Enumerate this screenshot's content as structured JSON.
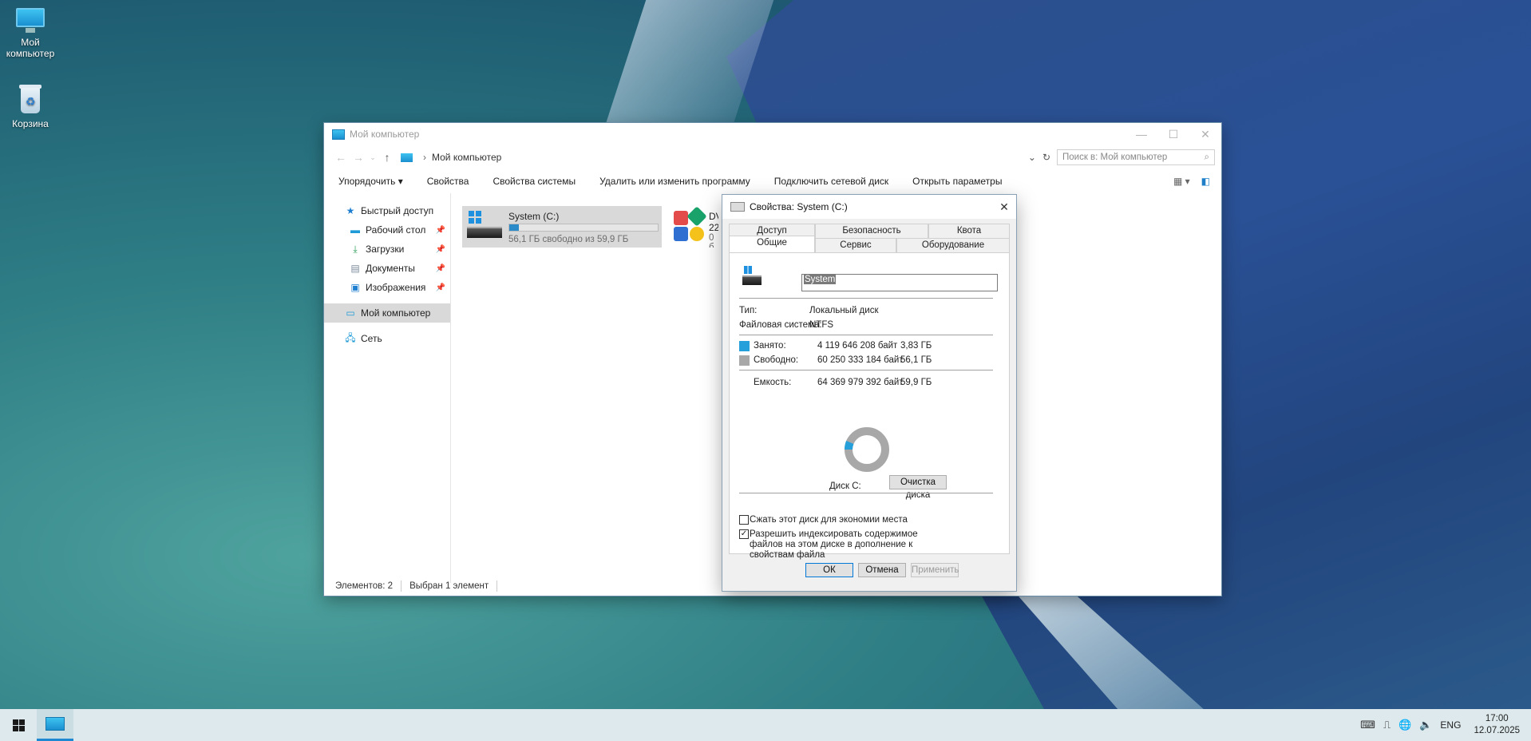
{
  "desktop": {
    "icons": [
      {
        "label": "Мой компьютер"
      },
      {
        "label": "Корзина"
      }
    ]
  },
  "explorer": {
    "title": "Мой компьютер",
    "breadcrumb": "Мой компьютер",
    "search_placeholder": "Поиск в: Мой компьютер",
    "commands": [
      "Упорядочить ▾",
      "Свойства",
      "Свойства системы",
      "Удалить или изменить программу",
      "Подключить сетевой диск",
      "Открыть параметры"
    ],
    "nav": {
      "quick_access": "Быстрый доступ",
      "desktop": "Рабочий стол",
      "downloads": "Загрузки",
      "documents": "Документы",
      "pictures": "Изображения",
      "this_pc": "Мой компьютер",
      "network": "Сеть"
    },
    "drives": [
      {
        "name": "System (C:)",
        "free_text": "56,1 ГБ свободно из 59,9 ГБ",
        "used_fraction": 0.064
      },
      {
        "name": "DV",
        "line2": "22",
        "line3": "0 б"
      }
    ],
    "status": {
      "items": "Элементов: 2",
      "selected": "Выбран 1 элемент"
    }
  },
  "dialog": {
    "title": "Свойства: System (C:)",
    "tabs_top": [
      "Доступ",
      "Безопасность",
      "Квота"
    ],
    "tabs_bottom": [
      "Общие",
      "Сервис",
      "Оборудование"
    ],
    "volume_name": "System",
    "type_label": "Тип:",
    "type_value": "Локальный диск",
    "fs_label": "Файловая система:",
    "fs_value": "NTFS",
    "used_label": "Занято:",
    "used_bytes": "4 119 646 208 байт",
    "used_gb": "3,83 ГБ",
    "free_label": "Свободно:",
    "free_bytes": "60 250 333 184 байт",
    "free_gb": "56,1 ГБ",
    "capacity_label": "Емкость:",
    "capacity_bytes": "64 369 979 392 байт",
    "capacity_gb": "59,9 ГБ",
    "used_fraction": 0.064,
    "used_color": "#26a0da",
    "free_color": "#a8a8a8",
    "disk_label": "Диск C:",
    "cleanup_button": "Очистка диска",
    "compress_label": "Сжать этот диск для экономии места",
    "compress_checked": false,
    "index_label": "Разрешить индексировать содержимое файлов на этом диске в дополнение к свойствам файла",
    "index_checked": true,
    "ok": "ОК",
    "cancel": "Отмена",
    "apply": "Применить"
  },
  "taskbar": {
    "lang": "ENG",
    "time": "17:00",
    "date": "12.07.2025"
  }
}
